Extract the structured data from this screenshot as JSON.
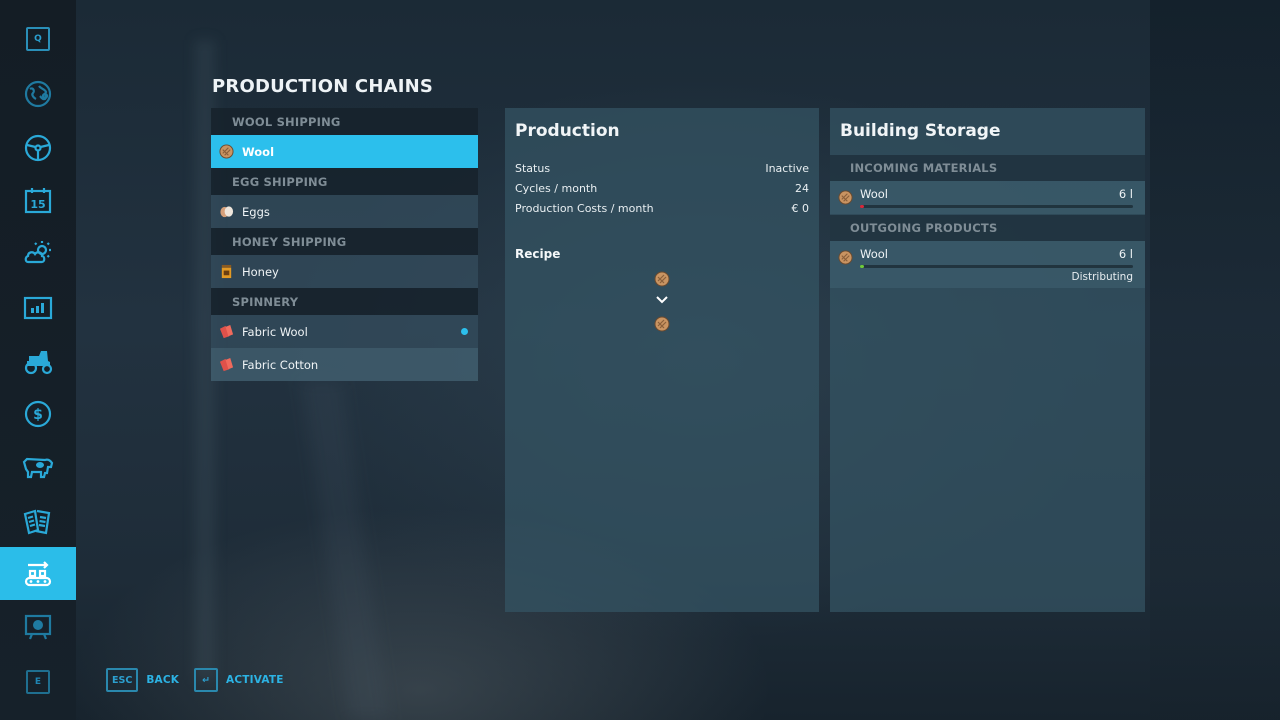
{
  "sidebar": {
    "top_key": "Q",
    "bottom_key": "E",
    "items": [
      {
        "icon": "map-icon",
        "active": false
      },
      {
        "icon": "steering-wheel-icon",
        "active": false
      },
      {
        "icon": "calendar-icon",
        "label": "15",
        "active": false
      },
      {
        "icon": "weather-icon",
        "active": false
      },
      {
        "icon": "statistics-icon",
        "active": false
      },
      {
        "icon": "tractor-icon",
        "active": false
      },
      {
        "icon": "finances-icon",
        "active": false
      },
      {
        "icon": "animals-icon",
        "active": false
      },
      {
        "icon": "contracts-icon",
        "active": false
      },
      {
        "icon": "production-chains-icon",
        "active": true
      },
      {
        "icon": "help-screen-icon",
        "active": false
      }
    ]
  },
  "page": {
    "title": "PRODUCTION CHAINS"
  },
  "chains": [
    {
      "header": "WOOL SHIPPING",
      "items": [
        {
          "label": "Wool",
          "icon": "wool-icon",
          "selected": true
        }
      ]
    },
    {
      "header": "EGG SHIPPING",
      "items": [
        {
          "label": "Eggs",
          "icon": "eggs-icon"
        }
      ]
    },
    {
      "header": "HONEY SHIPPING",
      "items": [
        {
          "label": "Honey",
          "icon": "honey-icon"
        }
      ]
    },
    {
      "header": "SPINNERY",
      "items": [
        {
          "label": "Fabric Wool",
          "icon": "fabric-icon",
          "indicator": true
        },
        {
          "label": "Fabric Cotton",
          "icon": "fabric-icon"
        }
      ]
    }
  ],
  "production": {
    "title": "Production",
    "rows": [
      {
        "label": "Status",
        "value": "Inactive"
      },
      {
        "label": "Cycles / month",
        "value": "24"
      },
      {
        "label": "Production Costs / month",
        "value": "€ 0"
      }
    ],
    "recipe_title": "Recipe",
    "recipe_input": "wool-icon",
    "recipe_output": "wool-icon"
  },
  "storage": {
    "title": "Building Storage",
    "incoming_header": "INCOMING MATERIALS",
    "incoming": [
      {
        "name": "Wool",
        "amount": "6 l",
        "fill_percent": 1,
        "bar_color": "#d8263a"
      }
    ],
    "outgoing_header": "OUTGOING PRODUCTS",
    "outgoing": [
      {
        "name": "Wool",
        "amount": "6 l",
        "fill_percent": 1,
        "bar_color": "#6fcb3a",
        "status": "Distributing"
      }
    ]
  },
  "footer": {
    "back_key": "ESC",
    "back_label": "BACK",
    "activate_key": "↵",
    "activate_label": "ACTIVATE"
  },
  "colors": {
    "accent": "#2cbfec",
    "icon_blue": "#2aa9d8"
  }
}
